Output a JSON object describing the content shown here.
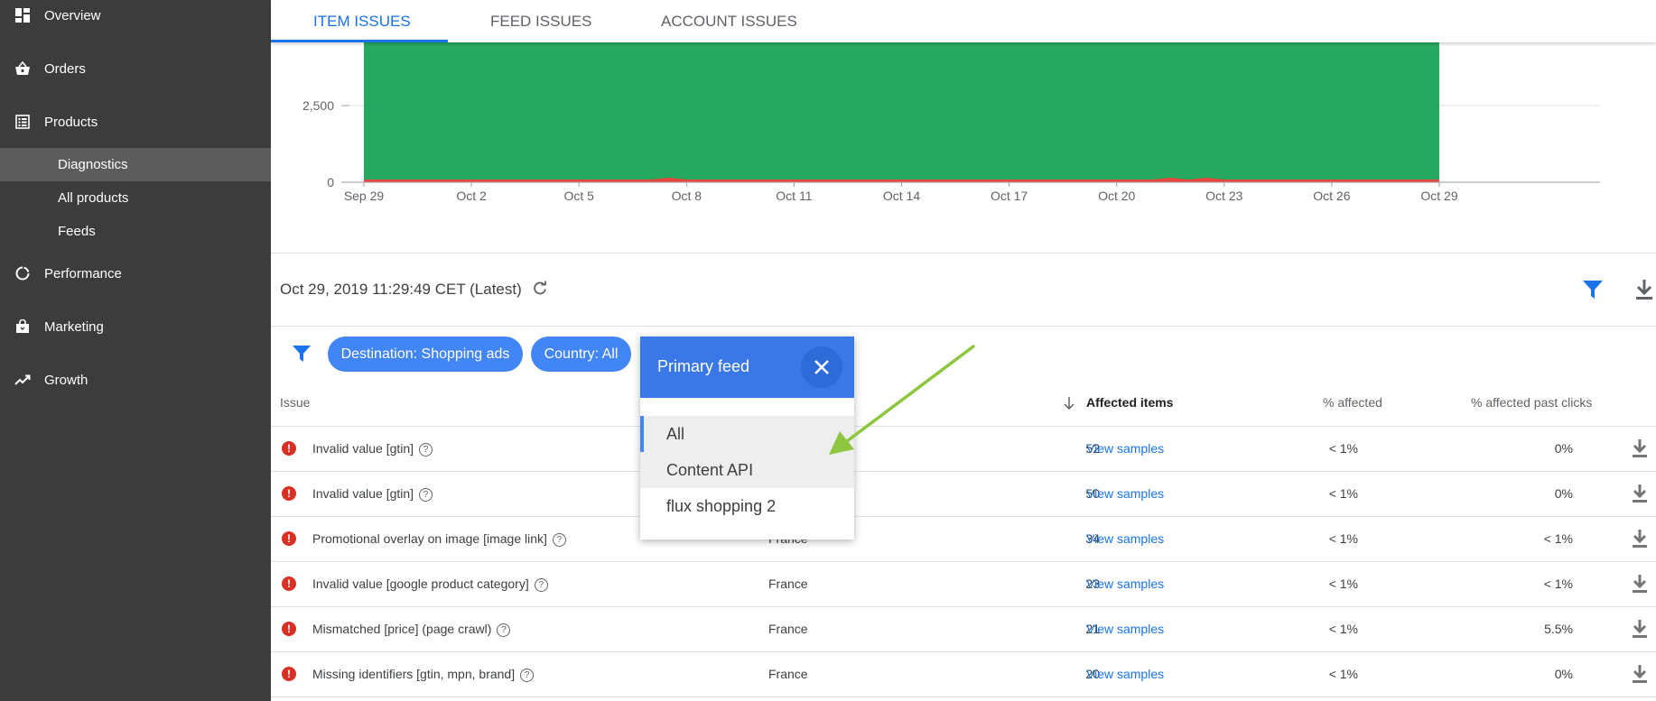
{
  "sidebar": {
    "items": [
      {
        "label": "Overview",
        "icon": "dashboard-icon"
      },
      {
        "label": "Orders",
        "icon": "basket-icon"
      },
      {
        "label": "Products",
        "icon": "list-icon"
      },
      {
        "label": "Performance",
        "icon": "performance-icon"
      },
      {
        "label": "Marketing",
        "icon": "shopping-bag-icon"
      },
      {
        "label": "Growth",
        "icon": "trending-up-icon"
      }
    ],
    "sub_items": [
      {
        "label": "Diagnostics",
        "active": true
      },
      {
        "label": "All products",
        "active": false
      },
      {
        "label": "Feeds",
        "active": false
      }
    ]
  },
  "tabs": [
    {
      "label": "ITEM ISSUES",
      "active": true
    },
    {
      "label": "FEED ISSUES",
      "active": false
    },
    {
      "label": "ACCOUNT ISSUES",
      "active": false
    }
  ],
  "chart_data": {
    "type": "area",
    "x": [
      "Sep 29",
      "Oct 2",
      "Oct 5",
      "Oct 8",
      "Oct 11",
      "Oct 14",
      "Oct 17",
      "Oct 20",
      "Oct 23",
      "Oct 26",
      "Oct 29"
    ],
    "y_ticks": [
      "0",
      "2,500"
    ],
    "series": [
      {
        "color": "#27a861",
        "description": "valid items (fills above visible range)"
      },
      {
        "color": "#e8453c",
        "description": "disapproved items, near zero"
      }
    ],
    "grid": true
  },
  "status": {
    "timestamp": "Oct 29, 2019 11:29:49 CET (Latest)"
  },
  "filters": {
    "chips": [
      "Destination: Shopping ads",
      "Country: All"
    ]
  },
  "table": {
    "headers": {
      "issue": "Issue",
      "affected": "Affected items",
      "pct_affected": "% affected",
      "pct_clicks": "% affected past clicks"
    },
    "link_label": "View samples",
    "rows": [
      {
        "issue": "Invalid value [gtin]",
        "country": "",
        "count": "52",
        "pct": "< 1%",
        "clicks": "0%"
      },
      {
        "issue": "Invalid value [gtin]",
        "country": "",
        "count": "50",
        "pct": "< 1%",
        "clicks": "0%"
      },
      {
        "issue": "Promotional overlay on image [image link]",
        "country": "France",
        "count": "34",
        "pct": "< 1%",
        "clicks": "< 1%"
      },
      {
        "issue": "Invalid value [google product category]",
        "country": "France",
        "count": "23",
        "pct": "< 1%",
        "clicks": "< 1%"
      },
      {
        "issue": "Mismatched [price] (page crawl)",
        "country": "France",
        "count": "21",
        "pct": "< 1%",
        "clicks": "5.5%"
      },
      {
        "issue": "Missing identifiers [gtin, mpn, brand]",
        "country": "France",
        "count": "20",
        "pct": "< 1%",
        "clicks": "0%"
      }
    ]
  },
  "dropdown": {
    "title": "Primary feed",
    "options": [
      "All",
      "Content API",
      "flux shopping 2"
    ],
    "selected": "All"
  },
  "colors": {
    "accent": "#1a73e8",
    "chip": "#4285f4",
    "sidebar": "#3c3c3c",
    "error": "#d93025",
    "chart_green": "#27a861",
    "chart_red": "#e8453c",
    "annotation_arrow": "#8dc63f"
  }
}
